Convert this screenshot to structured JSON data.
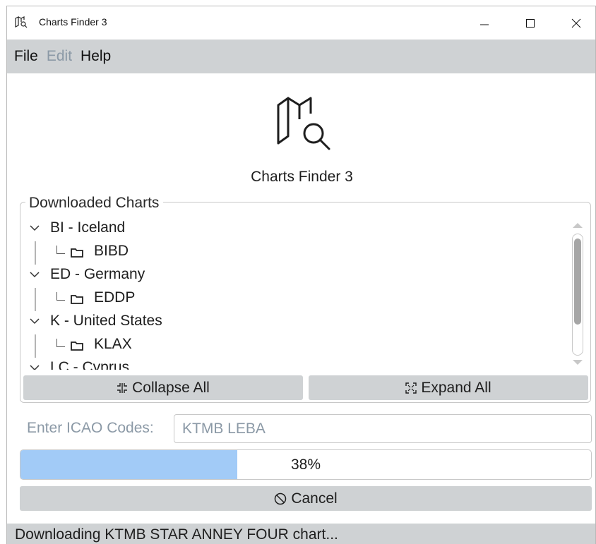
{
  "window": {
    "title": "Charts Finder 3"
  },
  "menubar": {
    "items": [
      {
        "label": "File",
        "enabled": true
      },
      {
        "label": "Edit",
        "enabled": false
      },
      {
        "label": "Help",
        "enabled": true
      }
    ]
  },
  "header": {
    "app_name": "Charts Finder 3",
    "icon": "map-search-icon"
  },
  "downloaded": {
    "title": "Downloaded Charts",
    "tree": [
      {
        "label": "BI - Iceland",
        "children": [
          "BIBD"
        ]
      },
      {
        "label": "ED - Germany",
        "children": [
          "EDDP"
        ]
      },
      {
        "label": "K - United States",
        "children": [
          "KLAX"
        ]
      },
      {
        "label": "LC - Cyprus",
        "children": []
      }
    ],
    "collapse_label": "Collapse All",
    "expand_label": "Expand All"
  },
  "icao": {
    "label": "Enter ICAO Codes:",
    "value": "KTMB LEBA"
  },
  "progress": {
    "value": 0.38,
    "text": "38%"
  },
  "cancel_label": "Cancel",
  "status": "Downloading KTMB STAR ANNEY FOUR chart...",
  "colors": {
    "menubar_bg": "#cfd2d4",
    "progress_fill": "#a2cbf7",
    "disabled_text": "#8b99a6"
  }
}
